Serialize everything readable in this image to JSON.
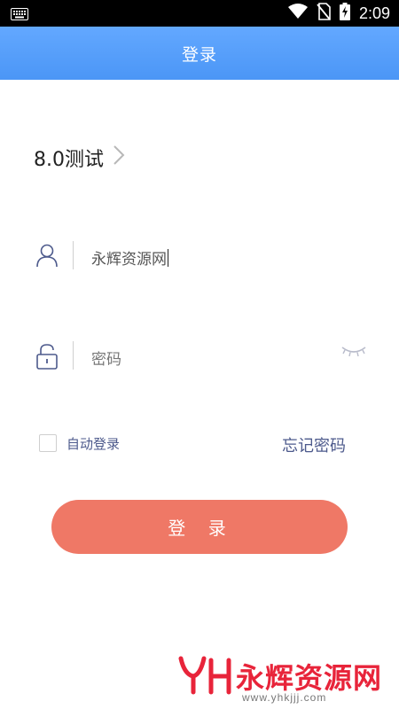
{
  "status_bar": {
    "time": "2:09",
    "icons": [
      "keyboard-icon",
      "wifi-icon",
      "no-sim-icon",
      "battery-charging-icon"
    ]
  },
  "header": {
    "title": "登录"
  },
  "app_selector": {
    "label": "8.0测试",
    "icon": "chevron-right-icon"
  },
  "username_field": {
    "icon": "user-icon",
    "value": "永辉资源网"
  },
  "password_field": {
    "icon": "lock-icon",
    "placeholder": "密码",
    "toggle_icon": "eye-closed-icon"
  },
  "auto_login": {
    "label": "自动登录",
    "checked": false
  },
  "forgot_password": {
    "label": "忘记密码"
  },
  "login_button": {
    "label": "登 录"
  },
  "watermark": {
    "text": "永辉资源网",
    "url": "www.yhkjjj.com"
  },
  "colors": {
    "header": "#4b96f6",
    "button": "#ef7866",
    "link": "#4d5a8c",
    "icon": "#4d5a8c",
    "watermark": "#e8243a"
  }
}
